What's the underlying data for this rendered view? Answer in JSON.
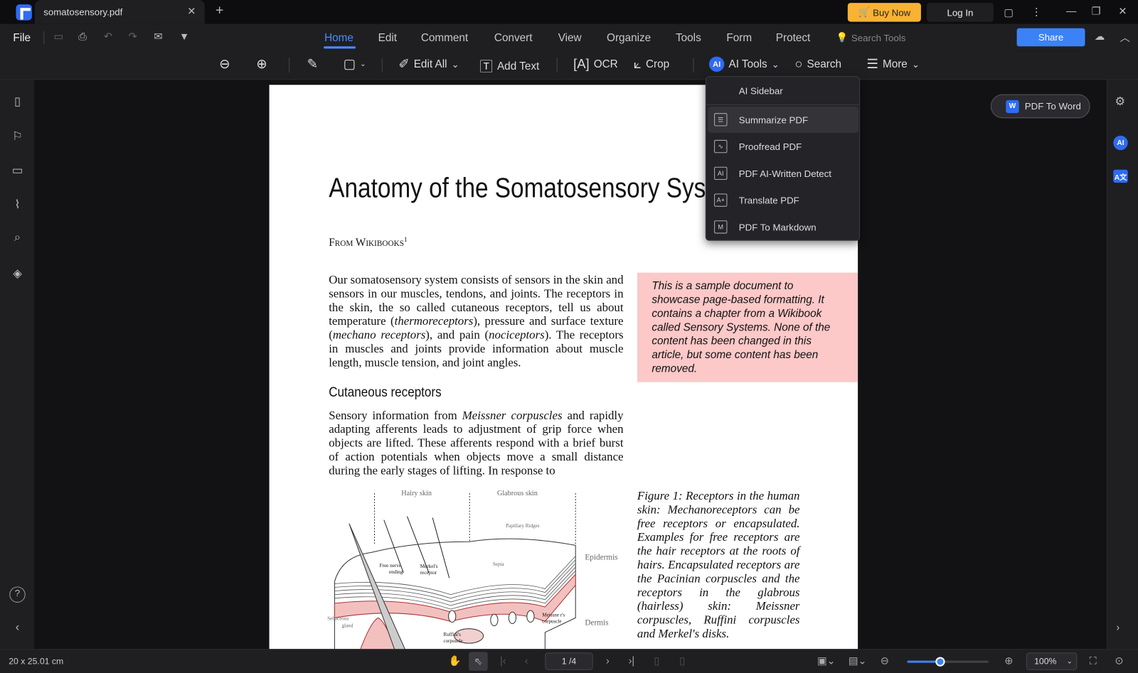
{
  "titlebar": {
    "tab_title": "somatosensory.pdf",
    "buy_now": "Buy Now",
    "log_in": "Log In"
  },
  "menubar": {
    "file": "File",
    "items": [
      "Home",
      "Edit",
      "Comment",
      "Convert",
      "View",
      "Organize",
      "Tools",
      "Form",
      "Protect"
    ],
    "active": "Home",
    "search_tools": "Search Tools",
    "share": "Share"
  },
  "toolbar": {
    "edit_all": "Edit All",
    "add_text": "Add Text",
    "ocr": "OCR",
    "crop": "Crop",
    "ai_tools": "AI Tools",
    "search": "Search",
    "more": "More"
  },
  "ai_menu": {
    "items": [
      "AI Sidebar",
      "Summarize PDF",
      "Proofread PDF",
      "PDF AI-Written Detect",
      "Translate PDF",
      "PDF To Markdown"
    ],
    "highlighted": "Summarize PDF"
  },
  "pdf_to_word": "PDF To Word",
  "ai_badge": "AI",
  "document": {
    "title": "Anatomy of the Somatosensory System",
    "from": "From Wikibooks",
    "footnote": "1",
    "para1": [
      {
        "t": "Our somatosensory system consists of sensors in the skin and sensors in our muscles, tendons, and joints. The receptors in the skin, the so called cutaneous receptors, tell us about temperature ("
      },
      {
        "t": "thermoreceptors",
        "i": true
      },
      {
        "t": "), pressure and surface texture ("
      },
      {
        "t": "mechano receptors",
        "i": true
      },
      {
        "t": "), and pain ("
      },
      {
        "t": "nociceptors",
        "i": true
      },
      {
        "t": "). The receptors in muscles and joints provide information about muscle length, muscle tension, and joint angles."
      }
    ],
    "heading": "Cutaneous receptors",
    "para2": [
      {
        "t": "Sensory information from "
      },
      {
        "t": "Meissner corpuscles",
        "i": true
      },
      {
        "t": " and rapidly adapting afferents leads to adjustment of grip force when objects are lifted. These afferents respond with a brief burst of action potentials when objects move a small distance during the early stages of lifting. In response to"
      }
    ],
    "note": "This is a sample document to showcase page-based formatting. It contains a chapter from a Wikibook called Sensory Systems. None of the content has been changed in this article, but some content has been removed.",
    "caption": "Figure 1:  Receptors in the human skin: Mechanoreceptors can be free receptors or encapsulated. Examples for free receptors are the hair receptors at the roots of hairs. Encapsulated receptors are the Pacinian corpuscles and the receptors in the glabrous (hairless) skin: Meissner corpuscles, Ruffini corpuscles and Merkel's disks.",
    "figure_labels": {
      "hairy": "Hairy skin",
      "glabrous": "Glabrous skin",
      "papillary": "Papillary Ridges",
      "epidermis": "Epidermis",
      "dermis": "Dermis",
      "free_nerve": "Free nerve",
      "ending": "ending",
      "merkel": "Merkel's",
      "receptor": "receptor",
      "septa": "Septa",
      "meissner": "Meissne r's",
      "corpuscle": "corpuscle",
      "sebaceous": "Sebaceous",
      "gland": "gland",
      "ruffini": "Ruffini's",
      "ruffini_corpuscle": "corpuscle"
    }
  },
  "statusbar": {
    "dimensions": "20 x 25.01 cm",
    "page": "1 /4",
    "zoom": "100%",
    "zoom_level_percent": 100,
    "zoom_slider_fraction": 0.4
  }
}
